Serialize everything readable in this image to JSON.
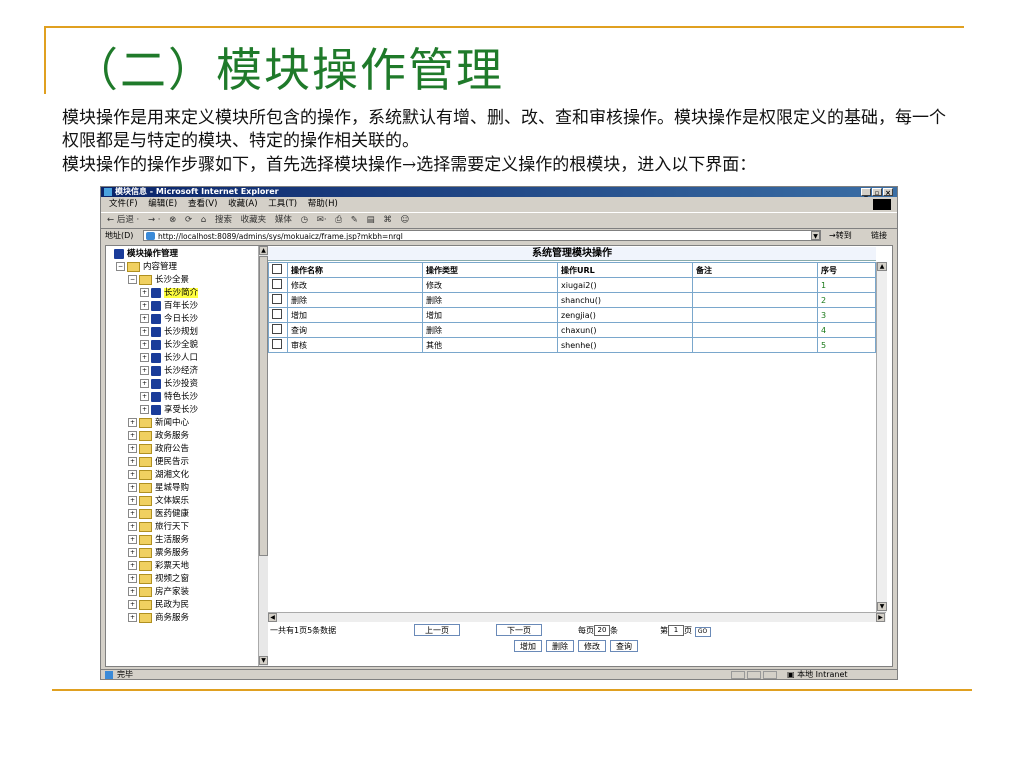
{
  "slide": {
    "title": "（二）模块操作管理",
    "para1": "模块操作是用来定义模块所包含的操作，系统默认有增、删、改、查和审核操作。模块操作是权限定义的基础，每一个权限都是与特定的模块、特定的操作相关联的。",
    "para2": "模块操作的操作步骤如下，首先选择模块操作→选择需要定义操作的根模块，进入以下界面："
  },
  "browser": {
    "window_title": "模块信息 - Microsoft Internet Explorer",
    "window_buttons": [
      "_",
      "▫",
      "×"
    ],
    "menu": [
      "文件(F)",
      "编辑(E)",
      "查看(V)",
      "收藏(A)",
      "工具(T)",
      "帮助(H)"
    ],
    "toolbar": [
      "← 后退 ·",
      "→ ·",
      "⊗",
      "⟳",
      "⌂",
      "搜索",
      "收藏夹",
      "媒体",
      "◷",
      "✉·",
      "⎙",
      "✎",
      "▤",
      "⌘",
      "☺"
    ],
    "address_label": "地址(D)",
    "address_url": "http://localhost:8089/admins/sys/mokuaicz/frame.jsp?mkbh=nrgl",
    "go_label": "转到",
    "links_label": "链接",
    "status_text": "完毕",
    "status_zone": "本地 Intranet"
  },
  "tree": {
    "root": "模块操作管理",
    "content_root": "内容管理",
    "group": "长沙全景",
    "group_children": [
      "长沙简介",
      "百年长沙",
      "今日长沙",
      "长沙规划",
      "长沙全貌",
      "长沙人口",
      "长沙经济",
      "长沙投资",
      "特色长沙",
      "享受长沙"
    ],
    "selected": "长沙简介",
    "other_nodes": [
      "新闻中心",
      "政务服务",
      "政府公告",
      "便民告示",
      "湖湘文化",
      "星城导购",
      "文体娱乐",
      "医药健康",
      "旅行天下",
      "生活服务",
      "票务服务",
      "彩票天地",
      "视频之窗",
      "房产家装",
      "民政为民",
      "商务服务"
    ]
  },
  "grid": {
    "title": "系统管理模块操作",
    "columns": [
      "操作名称",
      "操作类型",
      "操作URL",
      "备注",
      "序号"
    ],
    "rows": [
      {
        "name": "修改",
        "type": "修改",
        "url": "xiugai2()",
        "note": "",
        "seq": "1"
      },
      {
        "name": "删除",
        "type": "删除",
        "url": "shanchu()",
        "note": "",
        "seq": "2"
      },
      {
        "name": "增加",
        "type": "增加",
        "url": "zengjia()",
        "note": "",
        "seq": "3"
      },
      {
        "name": "查询",
        "type": "删除",
        "url": "chaxun()",
        "note": "",
        "seq": "4"
      },
      {
        "name": "审核",
        "type": "其他",
        "url": "shenhe()",
        "note": "",
        "seq": "5"
      }
    ]
  },
  "pager": {
    "summary": "一共有1页5条数据",
    "prev": "上一页",
    "next": "下一页",
    "per_page_prefix": "每页",
    "per_page_value": "20",
    "per_page_suffix": "条",
    "page_prefix": "第",
    "page_value": "1",
    "page_suffix": "页",
    "go": "GO"
  },
  "actions": [
    "增加",
    "删除",
    "修改",
    "查询"
  ]
}
